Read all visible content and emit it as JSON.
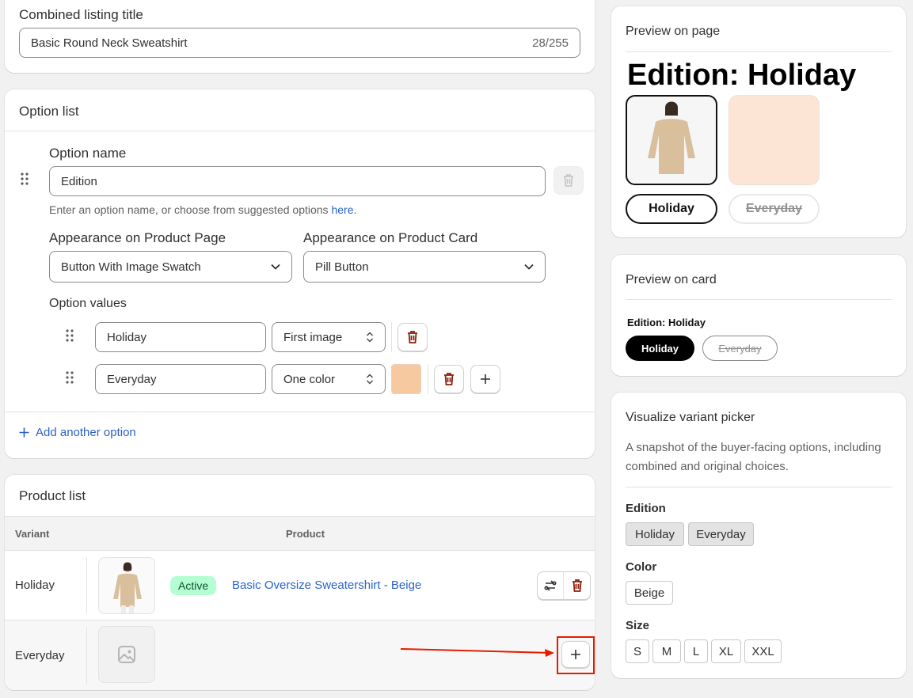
{
  "title_card": {
    "label": "Combined listing title",
    "value": "Basic Round Neck Sweatshirt",
    "counter": "28/255"
  },
  "option_list": {
    "title": "Option list",
    "option_name_label": "Option name",
    "option_name_value": "Edition",
    "helper_text": "Enter an option name, or choose from suggested options ",
    "helper_link": "here",
    "helper_end": ".",
    "appearance_page_label": "Appearance on Product Page",
    "appearance_page_value": "Button With Image Swatch",
    "appearance_card_label": "Appearance on Product Card",
    "appearance_card_value": "Pill Button",
    "values_label": "Option values",
    "values": [
      {
        "name": "Holiday",
        "type": "First image"
      },
      {
        "name": "Everyday",
        "type": "One color",
        "swatch_color": "#f7c9a0"
      }
    ],
    "add_option": "Add another option"
  },
  "product_list": {
    "title": "Product list",
    "col_variant": "Variant",
    "col_product": "Product",
    "rows": [
      {
        "variant": "Holiday",
        "status": "Active",
        "product": "Basic Oversize Sweatershirt - Beige"
      },
      {
        "variant": "Everyday"
      }
    ]
  },
  "preview_page": {
    "title": "Preview on page",
    "heading": "Edition: Holiday",
    "buttons": [
      "Holiday",
      "Everyday"
    ],
    "swatch_color": "#fde5d6"
  },
  "preview_card": {
    "title": "Preview on card",
    "label": "Edition: Holiday",
    "pills": [
      "Holiday",
      "Everyday"
    ]
  },
  "visualize": {
    "title": "Visualize variant picker",
    "description": "A snapshot of the buyer-facing options, including combined and original choices.",
    "groups": [
      {
        "name": "Edition",
        "values": [
          "Holiday",
          "Everyday"
        ]
      },
      {
        "name": "Color",
        "values": [
          "Beige"
        ]
      },
      {
        "name": "Size",
        "values": [
          "S",
          "M",
          "L",
          "XL",
          "XXL"
        ]
      }
    ]
  },
  "colors": {
    "accent_link": "#2a62c9",
    "delete_red": "#8e1f0b",
    "active_badge": "#b4fed2",
    "highlight_box": "#e51c00"
  }
}
